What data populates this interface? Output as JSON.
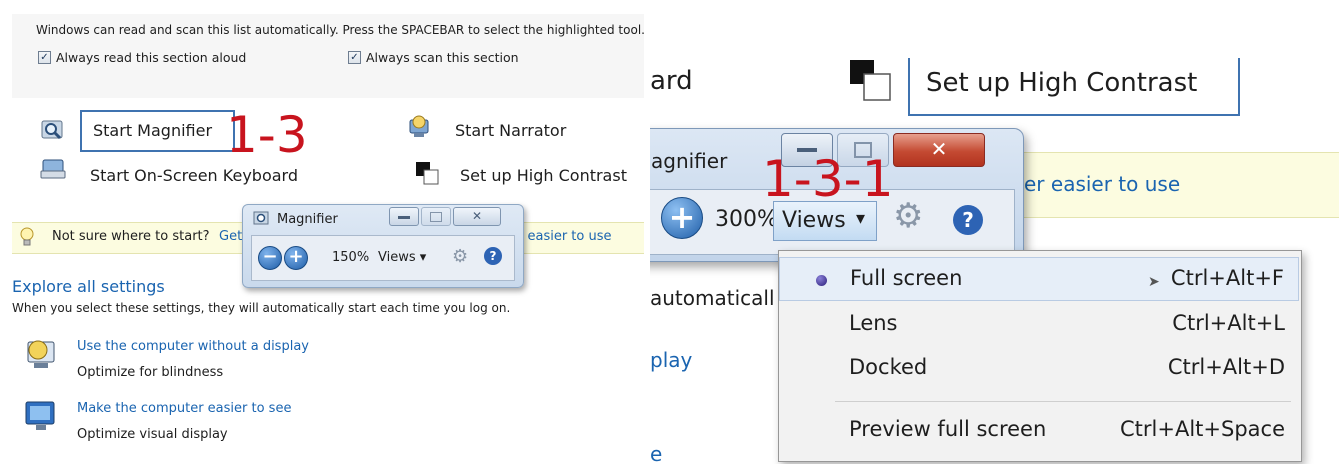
{
  "left": {
    "instruction": "Windows can read and scan this list automatically. Press the SPACEBAR to select the highlighted tool.",
    "checkbox_read": "Always read this section aloud",
    "checkbox_scan": "Always scan this section",
    "tools": {
      "start_magnifier": "Start Magnifier",
      "start_narrator": "Start Narrator",
      "start_osk": "Start On-Screen Keyboard",
      "setup_high_contrast": "Set up High Contrast"
    },
    "step_label": "1-3",
    "tip_text": "Not sure where to start?",
    "tip_link_start": "Get",
    "tip_link_end": "r easier to use",
    "explore_title": "Explore all settings",
    "explore_sub": "When you select these settings, they will automatically start each time you log on.",
    "settings": [
      {
        "link": "Use the computer without a display",
        "sub": "Optimize for blindness"
      },
      {
        "link": "Make the computer easier to see",
        "sub": "Optimize visual display"
      }
    ],
    "mini_window": {
      "title": "Magnifier",
      "zoom": "150%",
      "views": "Views"
    }
  },
  "right": {
    "cut_board": "ard",
    "high_contrast": "Set up High Contrast",
    "easier_text": "er easier to use",
    "automatic_text": "automaticall",
    "display_text": "play",
    "e_text": "e",
    "step_label": "1-3-1",
    "magnifier_window": {
      "title": "agnifier",
      "zoom": "300%",
      "views": "Views"
    },
    "views_menu": [
      {
        "label": "Full screen",
        "shortcut": "Ctrl+Alt+F",
        "selected": true
      },
      {
        "label": "Lens",
        "shortcut": "Ctrl+Alt+L",
        "selected": false
      },
      {
        "label": "Docked",
        "shortcut": "Ctrl+Alt+D",
        "selected": false
      },
      {
        "label": "Preview full screen",
        "shortcut": "Ctrl+Alt+Space",
        "selected": false
      }
    ]
  },
  "colors": {
    "step_label": "#c8141e",
    "link": "#1a64b0",
    "focus_box": "#3f73b0"
  }
}
